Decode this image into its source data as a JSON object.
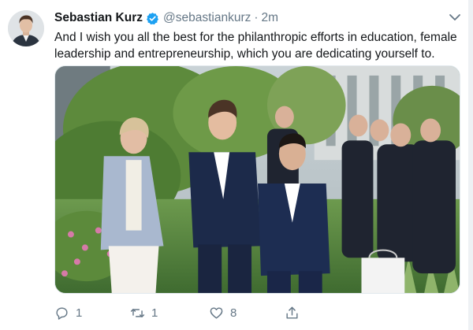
{
  "user": {
    "display_name": "Sebastian Kurz",
    "handle": "@sebastiankurz",
    "separator": "·",
    "time": "2m",
    "verified": true
  },
  "tweet": {
    "text": "And I wish you all the best for the philanthropic efforts in education, female leadership and entrepreneurship, which you are dedicating yourself to."
  },
  "actions": {
    "reply_count": "1",
    "retweet_count": "1",
    "like_count": "8"
  },
  "icons": {
    "verified": "verified-badge-icon",
    "caret": "chevron-down-icon",
    "reply": "reply-icon",
    "retweet": "retweet-icon",
    "like": "heart-icon",
    "share": "share-icon"
  },
  "colors": {
    "text": "#14171a",
    "muted": "#657786",
    "verified_blue": "#1da1f2"
  }
}
